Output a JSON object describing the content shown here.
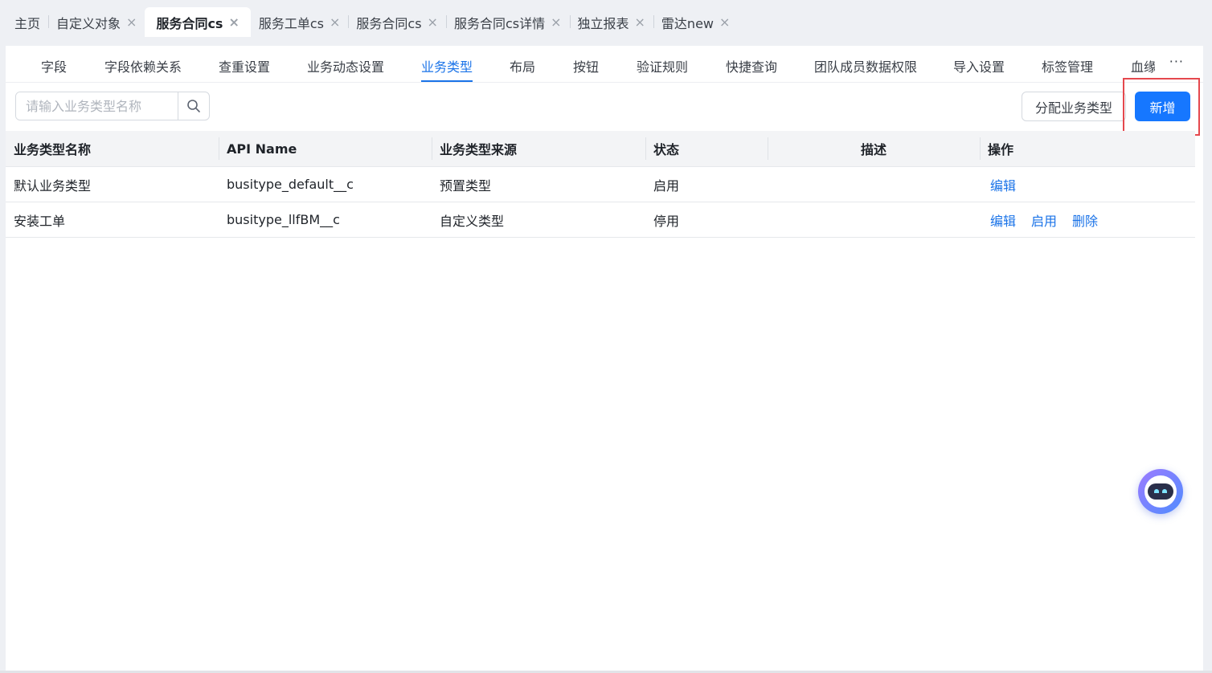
{
  "window_tabs": [
    {
      "label": "主页",
      "closable": false,
      "active": false
    },
    {
      "label": "自定义对象",
      "closable": true,
      "active": false
    },
    {
      "label": "服务合同cs",
      "closable": true,
      "active": true
    },
    {
      "label": "服务工单cs",
      "closable": true,
      "active": false
    },
    {
      "label": "服务合同cs",
      "closable": true,
      "active": false
    },
    {
      "label": "服务合同cs详情",
      "closable": true,
      "active": false
    },
    {
      "label": "独立报表",
      "closable": true,
      "active": false
    },
    {
      "label": "雷达new",
      "closable": true,
      "active": false
    }
  ],
  "close_glyph": "×",
  "sub_tabs": [
    {
      "label": "字段",
      "active": false
    },
    {
      "label": "字段依赖关系",
      "active": false
    },
    {
      "label": "查重设置",
      "active": false
    },
    {
      "label": "业务动态设置",
      "active": false
    },
    {
      "label": "业务类型",
      "active": true
    },
    {
      "label": "布局",
      "active": false
    },
    {
      "label": "按钮",
      "active": false
    },
    {
      "label": "验证规则",
      "active": false
    },
    {
      "label": "快捷查询",
      "active": false
    },
    {
      "label": "团队成员数据权限",
      "active": false
    },
    {
      "label": "导入设置",
      "active": false
    },
    {
      "label": "标签管理",
      "active": false
    },
    {
      "label": "血缘",
      "active": false
    }
  ],
  "more_label": "···",
  "toolbar": {
    "search_placeholder": "请输入业务类型名称",
    "search_value": "",
    "assign_label": "分配业务类型",
    "add_label": "新增"
  },
  "table": {
    "columns": [
      "业务类型名称",
      "API Name",
      "业务类型来源",
      "状态",
      "描述",
      "操作"
    ],
    "rows": [
      {
        "name": "默认业务类型",
        "api_name": "busitype_default__c",
        "source": "预置类型",
        "status": "启用",
        "description": "",
        "actions": [
          "编辑"
        ]
      },
      {
        "name": "安装工单",
        "api_name": "busitype_llfBM__c",
        "source": "自定义类型",
        "status": "停用",
        "description": "",
        "actions": [
          "编辑",
          "启用",
          "删除"
        ]
      }
    ]
  },
  "colors": {
    "accent": "#1677ff",
    "link": "#1a73e8",
    "highlight": "#e5484d"
  },
  "icons": {
    "search": "search-icon",
    "close": "close-icon",
    "more": "more-icon",
    "assistant": "robot-assistant-icon"
  }
}
